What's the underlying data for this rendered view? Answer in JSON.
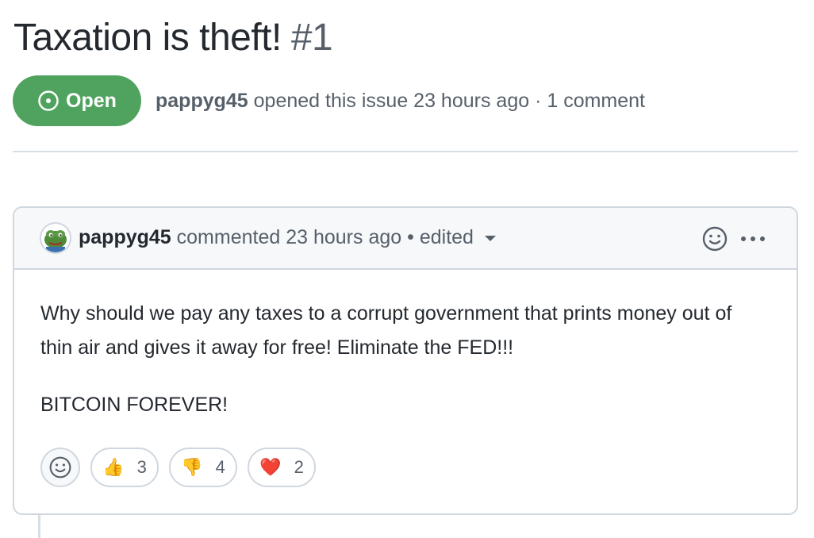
{
  "issue": {
    "title": "Taxation is theft!",
    "number": "#1",
    "state": "Open",
    "author": "pappyg45",
    "meta_text": "opened this issue 23 hours ago · 1 comment"
  },
  "comment": {
    "author": "pappyg45",
    "action": "commented 23 hours ago",
    "separator": "•",
    "edited": "edited",
    "body": [
      "Why should we pay any taxes to a corrupt government that prints money out of thin air and gives it away for free! Eliminate the FED!!!",
      "BITCOIN FOREVER!"
    ],
    "reactions": [
      {
        "emoji": "👍",
        "icon": "thumbs-up-icon",
        "count": "3"
      },
      {
        "emoji": "👎",
        "icon": "thumbs-down-icon",
        "count": "4"
      },
      {
        "emoji": "❤️",
        "icon": "heart-icon",
        "count": "2"
      }
    ]
  },
  "colors": {
    "open_badge": "#4fa35e",
    "muted_text": "#57606a",
    "border": "#d0d7de",
    "header_bg": "#f6f8fa"
  }
}
